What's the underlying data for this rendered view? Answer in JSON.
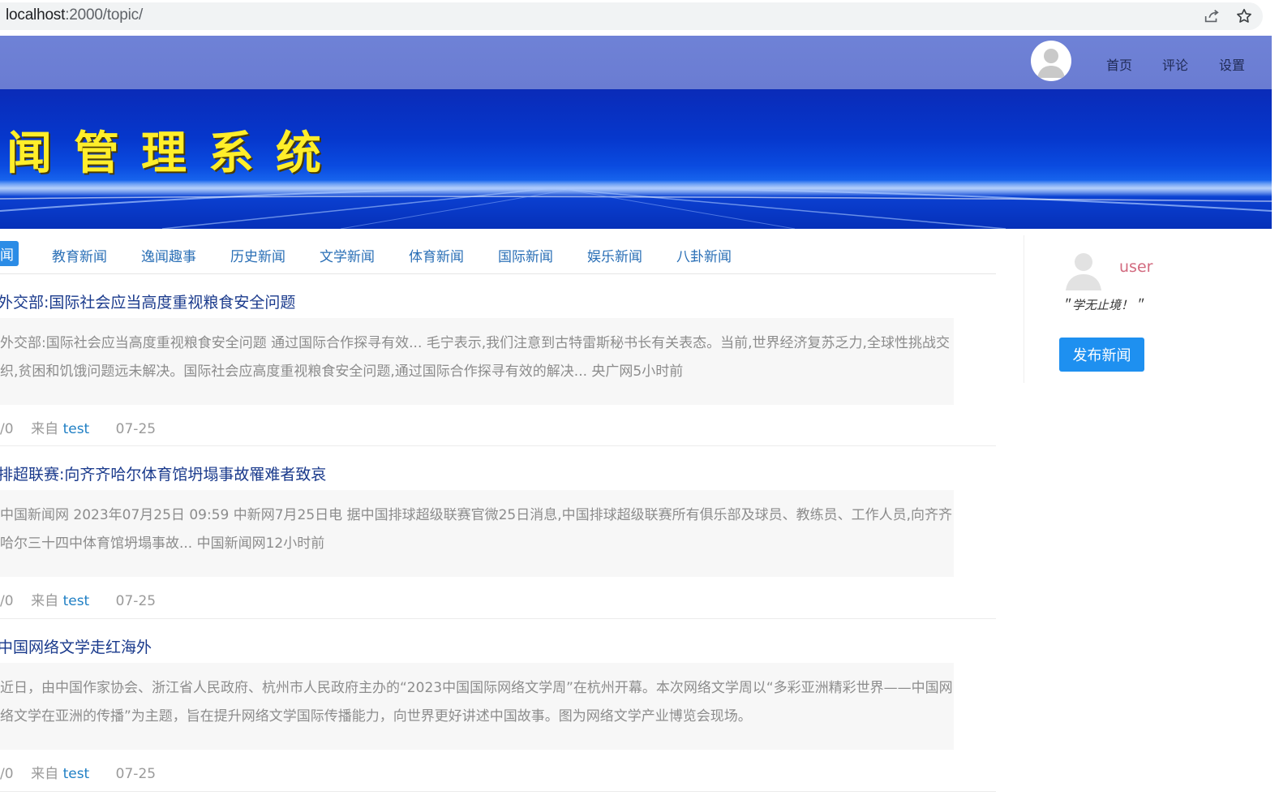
{
  "browser": {
    "url_host": "localhost",
    "url_rest": ":2000/topic/",
    "share_icon": "share-icon",
    "bookmark_icon": "star-icon"
  },
  "topnav": {
    "links": [
      "首页",
      "评论",
      "设置"
    ],
    "avatar_icon": "user-avatar-icon"
  },
  "banner": {
    "title": "闻管理系统"
  },
  "categories": {
    "active": "闻",
    "items": [
      "教育新闻",
      "逸闻趣事",
      "历史新闻",
      "文学新闻",
      "体育新闻",
      "国际新闻",
      "娱乐新闻",
      "八卦新闻"
    ]
  },
  "news": [
    {
      "title": "外交部:国际社会应当高度重视粮食安全问题",
      "summary": "外交部:国际社会应当高度重视粮食安全问题 通过国际合作探寻有效... 毛宁表示,我们注意到古特雷斯秘书长有关表态。当前,世界经济复苏乏力,全球性挑战交织,贫困和饥饿问题远未解决。国际社会应高度重视粮食安全问题,通过国际合作探寻有效的解决... 央广网5小时前",
      "stats": "/0",
      "from": "来自",
      "author": "test",
      "date": "07-25"
    },
    {
      "title": "排超联赛:向齐齐哈尔体育馆坍塌事故罹难者致哀",
      "summary": "中国新闻网 2023年07月25日 09:59 中新网7月25日电 据中国排球超级联赛官微25日消息,中国排球超级联赛所有俱乐部及球员、教练员、工作人员,向齐齐哈尔三十四中体育馆坍塌事故... 中国新闻网12小时前",
      "stats": "/0",
      "from": "来自",
      "author": "test",
      "date": "07-25"
    },
    {
      "title": "中国网络文学走红海外",
      "summary": "近日，由中国作家协会、浙江省人民政府、杭州市人民政府主办的“2023中国国际网络文学周”在杭州开幕。本次网络文学周以“多彩亚洲精彩世界——中国网络文学在亚洲的传播”为主题，旨在提升网络文学国际传播能力，向世界更好讲述中国故事。图为网络文学产业博览会现场。",
      "stats": "/0",
      "from": "来自",
      "author": "test",
      "date": "07-25"
    }
  ],
  "sidebar": {
    "username": "user",
    "motto": "＂学无止境！＂",
    "publish_label": "发布新闻"
  },
  "colors": {
    "nav_bg": "#6a7cd2",
    "banner_bg": "#0637cc",
    "banner_title": "#ffee2a",
    "accent": "#1e90f0",
    "link": "#2a6fb6"
  }
}
